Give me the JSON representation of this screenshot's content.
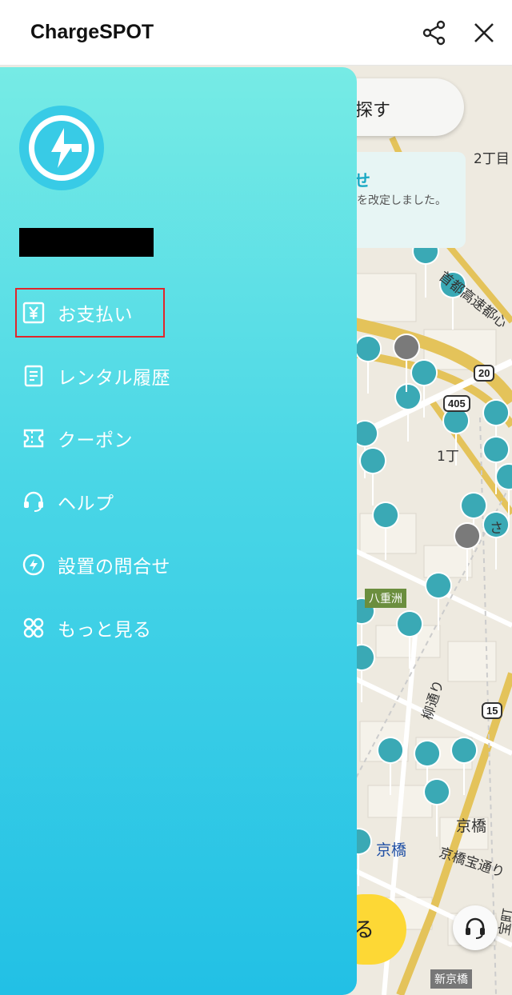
{
  "app": {
    "title": "ChargeSPOT"
  },
  "topbar": {
    "share_icon": "share-icon",
    "close_icon": "close-icon"
  },
  "drawer": {
    "logo_icon": "lightning-bolt-icon",
    "menu": [
      {
        "label": "お支払い",
        "icon": "yen-icon"
      },
      {
        "label": "レンタル履歴",
        "icon": "document-icon"
      },
      {
        "label": "クーポン",
        "icon": "ticket-icon"
      },
      {
        "label": "ヘルプ",
        "icon": "headset-icon"
      },
      {
        "label": "設置の問合せ",
        "icon": "install-inquiry-icon"
      },
      {
        "label": "もっと見る",
        "icon": "more-icon"
      }
    ]
  },
  "map": {
    "search_fragment": "探す",
    "notice_title": "せ",
    "notice_body": "を改定しました。",
    "button_fragment": "る",
    "labels": [
      "2丁目",
      "首都高速都心",
      "1丁",
      "八重洲",
      "柳通り",
      "京橋",
      "京橋",
      "京橋宝通り",
      "新京橋",
      "宝町",
      "さ"
    ],
    "route_numbers": [
      "20",
      "405",
      "15"
    ]
  },
  "colors": {
    "accent": "#2bc4e4",
    "highlight": "#e0262b",
    "pin": "#3aa9b5",
    "pin_inactive": "#7a7a7a"
  }
}
